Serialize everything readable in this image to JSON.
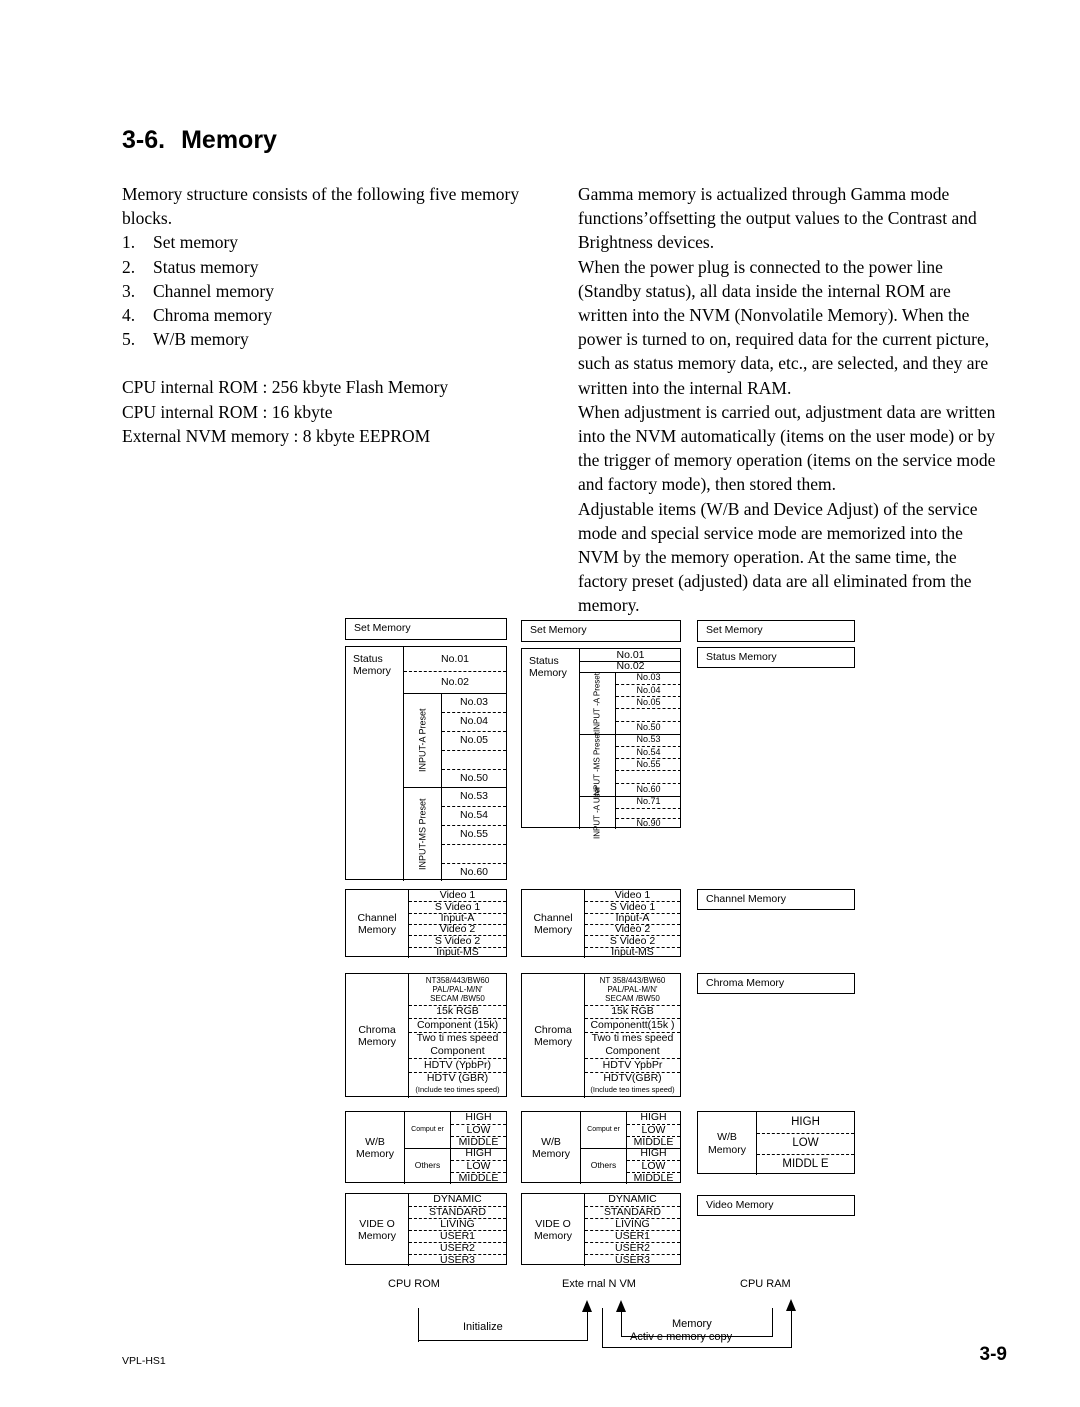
{
  "heading": {
    "number": "3-6.",
    "title": "Memory"
  },
  "left_column": {
    "intro": "Memory structure consists of the following five memory blocks.",
    "list": [
      {
        "index": "1.",
        "label": "Set memory"
      },
      {
        "index": "2.",
        "label": "Status memory"
      },
      {
        "index": "3.",
        "label": "Channel memory"
      },
      {
        "index": "4.",
        "label": "Chroma memory"
      },
      {
        "index": "5.",
        "label": "W/B memory"
      }
    ],
    "specs": [
      "CPU internal ROM : 256 kbyte Flash Memory",
      "CPU internal ROM : 16 kbyte",
      "External NVM memory : 8 kbyte EEPROM"
    ]
  },
  "right_column": {
    "paragraphs": [
      "Gamma memory is actualized through Gamma mode functions’offsetting the output values to the Contrast and Brightness devices.",
      "When the power plug is connected to the power line (Standby status), all data inside the internal ROM are written into the NVM (Nonvolatile Memory). When the power is turned to on, required data for the current picture, such as status memory data, etc., are selected, and they are written into the internal RAM.",
      "When adjustment is carried out, adjustment data are written into the NVM automatically (items on the user mode) or by the trigger of memory operation (items on the service mode and factory mode), then stored them.",
      "Adjustable items (W/B and Device Adjust) of the service mode and special service mode are memorized into the NVM by the memory operation. At the same time, the factory preset (adjusted) data are all eliminated from the memory."
    ]
  },
  "diagram": {
    "columns": {
      "cpu_rom": {
        "set_memory": "Set Memory",
        "status_memory": "Status Memory",
        "status_rows_top": [
          "No.01",
          "No.02"
        ],
        "groups": [
          {
            "label": "INPUT-A Preset",
            "rows": [
              "No.03",
              "No.04",
              "No.05",
              "",
              "No.50"
            ]
          },
          {
            "label": "INPUT-MS Preset",
            "rows": [
              "No.53",
              "No.54",
              "No.55",
              "",
              "No.60"
            ]
          }
        ],
        "channel_memory": "Channel Memory",
        "channel_rows": [
          "Video 1",
          "S Video 1",
          "Input-A",
          "Video 2",
          "S Video 2",
          "Input-MS"
        ],
        "chroma_memory": "Chroma Memory",
        "chroma_rows": [
          "NT358/443/BW60",
          "PAL/PAL-M/N'",
          "SECAM /BW50",
          "15k RGB",
          "Component (15k)",
          "Two ti mes speed",
          "Component",
          "HDTV  (YpbPr)",
          "HDTV (GBR)",
          "(Include teo times speed)"
        ],
        "wb_memory": "W/B Memory",
        "wb_groups": [
          {
            "label": "Comput er",
            "rows": [
              "HIGH",
              "LOW",
              "MIDDLE"
            ]
          },
          {
            "label": "Others",
            "rows": [
              "HIGH",
              "LOW",
              "MIDDLE"
            ]
          }
        ],
        "video_memory": "VIDE O Memory",
        "video_rows": [
          "DYNAMIC",
          "STANDARD",
          "LIVING",
          "USER1",
          "USER2",
          "USER3"
        ],
        "footer_label": "CPU ROM"
      },
      "external_nvm": {
        "set_memory": "Set Memory",
        "status_memory": "Status Memory",
        "status_rows_top": [
          "No.01",
          "No.02"
        ],
        "groups": [
          {
            "label": "INPUT -A Preset",
            "rows": [
              "No.03",
              "No.04",
              "No.05",
              "",
              "No.50"
            ]
          },
          {
            "label": "INPUT -MS Preset",
            "rows": [
              "No.53",
              "No.54",
              "No.55",
              "",
              "No.60"
            ]
          },
          {
            "label": "INPUT -A User",
            "rows": [
              "No.71",
              "",
              "No.90"
            ]
          }
        ],
        "channel_memory": "Channel Memory",
        "channel_rows": [
          "Video 1",
          "S Video 1",
          "Input-A",
          "Video 2",
          "S Video 2",
          "Input-MS"
        ],
        "chroma_memory": "Chroma Memory",
        "chroma_rows": [
          "NT 358/443/BW60",
          "PAL/PAL-M/N'",
          "SECAM /BW50",
          "15k RGB",
          "Componentt(15k )",
          "Two ti mes speed",
          "Component",
          "HDTV  YpbPr",
          "HDTV(GBR)",
          "(Include teo times speed)"
        ],
        "wb_memory": "W/B Memory",
        "wb_groups": [
          {
            "label": "Comput er",
            "rows": [
              "HIGH",
              "LOW",
              "MIDDLE"
            ]
          },
          {
            "label": "Others",
            "rows": [
              "HIGH",
              "LOW",
              "MIDDLE"
            ]
          }
        ],
        "video_memory": "VIDE O Memory",
        "video_rows": [
          "DYNAMIC",
          "STANDARD",
          "LIVING",
          "USER1",
          "USER2",
          "USER3"
        ],
        "footer_label": "Exte rnal N VM"
      },
      "cpu_ram": {
        "set_memory": "Set Memory",
        "status_memory": "Status Memory",
        "channel_memory": "Channel Memory",
        "chroma_memory": "Chroma Memory",
        "wb_memory": "W/B Memory",
        "wb_rows": [
          "HIGH",
          "LOW",
          "MIDDL E"
        ],
        "video_memory": "Video Memory",
        "footer_label": "CPU RAM"
      }
    },
    "arrows": [
      {
        "label": "Initialize"
      },
      {
        "label": "Memory"
      },
      {
        "label": "Activ e memory copy"
      }
    ]
  },
  "footer": {
    "model": "VPL-HS1",
    "page": "3-9"
  }
}
